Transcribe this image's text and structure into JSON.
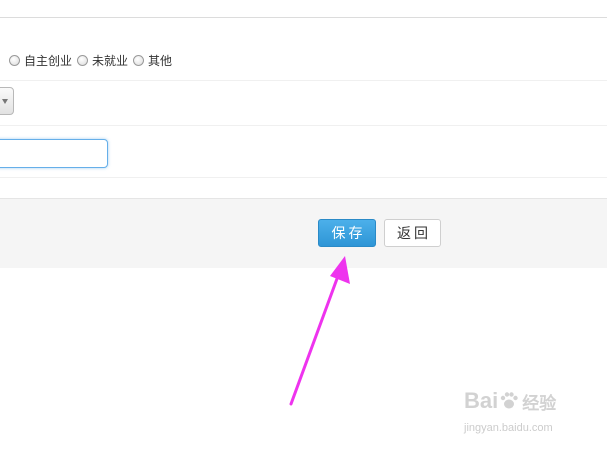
{
  "form": {
    "radio_options": [
      {
        "label": "自主创业",
        "checked": false
      },
      {
        "label": "未就业",
        "checked": false
      },
      {
        "label": "其他",
        "checked": false
      }
    ],
    "text_input": {
      "value": ""
    }
  },
  "footer": {
    "save_label": "保存",
    "back_label": "返回"
  },
  "colors": {
    "accent": "#33a0e0",
    "annotation": "#ee33ee",
    "footer_bg": "#f5f5f5"
  },
  "watermark": {
    "brand_left": "Bai",
    "brand_right": "经验",
    "url": "jingyan.baidu.com"
  }
}
